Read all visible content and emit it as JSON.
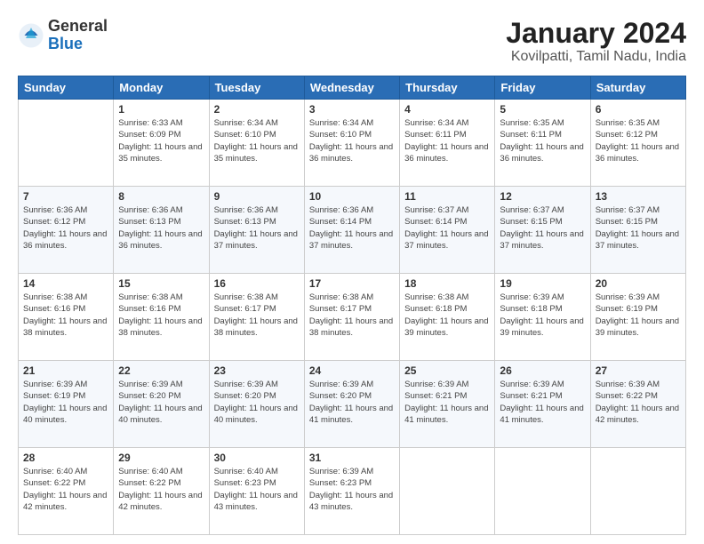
{
  "header": {
    "logo_general": "General",
    "logo_blue": "Blue",
    "main_title": "January 2024",
    "subtitle": "Kovilpatti, Tamil Nadu, India"
  },
  "days_of_week": [
    "Sunday",
    "Monday",
    "Tuesday",
    "Wednesday",
    "Thursday",
    "Friday",
    "Saturday"
  ],
  "weeks": [
    [
      {
        "day": "",
        "sunrise": "",
        "sunset": "",
        "daylight": ""
      },
      {
        "day": "1",
        "sunrise": "Sunrise: 6:33 AM",
        "sunset": "Sunset: 6:09 PM",
        "daylight": "Daylight: 11 hours and 35 minutes."
      },
      {
        "day": "2",
        "sunrise": "Sunrise: 6:34 AM",
        "sunset": "Sunset: 6:10 PM",
        "daylight": "Daylight: 11 hours and 35 minutes."
      },
      {
        "day": "3",
        "sunrise": "Sunrise: 6:34 AM",
        "sunset": "Sunset: 6:10 PM",
        "daylight": "Daylight: 11 hours and 36 minutes."
      },
      {
        "day": "4",
        "sunrise": "Sunrise: 6:34 AM",
        "sunset": "Sunset: 6:11 PM",
        "daylight": "Daylight: 11 hours and 36 minutes."
      },
      {
        "day": "5",
        "sunrise": "Sunrise: 6:35 AM",
        "sunset": "Sunset: 6:11 PM",
        "daylight": "Daylight: 11 hours and 36 minutes."
      },
      {
        "day": "6",
        "sunrise": "Sunrise: 6:35 AM",
        "sunset": "Sunset: 6:12 PM",
        "daylight": "Daylight: 11 hours and 36 minutes."
      }
    ],
    [
      {
        "day": "7",
        "sunrise": "Sunrise: 6:36 AM",
        "sunset": "Sunset: 6:12 PM",
        "daylight": "Daylight: 11 hours and 36 minutes."
      },
      {
        "day": "8",
        "sunrise": "Sunrise: 6:36 AM",
        "sunset": "Sunset: 6:13 PM",
        "daylight": "Daylight: 11 hours and 36 minutes."
      },
      {
        "day": "9",
        "sunrise": "Sunrise: 6:36 AM",
        "sunset": "Sunset: 6:13 PM",
        "daylight": "Daylight: 11 hours and 37 minutes."
      },
      {
        "day": "10",
        "sunrise": "Sunrise: 6:36 AM",
        "sunset": "Sunset: 6:14 PM",
        "daylight": "Daylight: 11 hours and 37 minutes."
      },
      {
        "day": "11",
        "sunrise": "Sunrise: 6:37 AM",
        "sunset": "Sunset: 6:14 PM",
        "daylight": "Daylight: 11 hours and 37 minutes."
      },
      {
        "day": "12",
        "sunrise": "Sunrise: 6:37 AM",
        "sunset": "Sunset: 6:15 PM",
        "daylight": "Daylight: 11 hours and 37 minutes."
      },
      {
        "day": "13",
        "sunrise": "Sunrise: 6:37 AM",
        "sunset": "Sunset: 6:15 PM",
        "daylight": "Daylight: 11 hours and 37 minutes."
      }
    ],
    [
      {
        "day": "14",
        "sunrise": "Sunrise: 6:38 AM",
        "sunset": "Sunset: 6:16 PM",
        "daylight": "Daylight: 11 hours and 38 minutes."
      },
      {
        "day": "15",
        "sunrise": "Sunrise: 6:38 AM",
        "sunset": "Sunset: 6:16 PM",
        "daylight": "Daylight: 11 hours and 38 minutes."
      },
      {
        "day": "16",
        "sunrise": "Sunrise: 6:38 AM",
        "sunset": "Sunset: 6:17 PM",
        "daylight": "Daylight: 11 hours and 38 minutes."
      },
      {
        "day": "17",
        "sunrise": "Sunrise: 6:38 AM",
        "sunset": "Sunset: 6:17 PM",
        "daylight": "Daylight: 11 hours and 38 minutes."
      },
      {
        "day": "18",
        "sunrise": "Sunrise: 6:38 AM",
        "sunset": "Sunset: 6:18 PM",
        "daylight": "Daylight: 11 hours and 39 minutes."
      },
      {
        "day": "19",
        "sunrise": "Sunrise: 6:39 AM",
        "sunset": "Sunset: 6:18 PM",
        "daylight": "Daylight: 11 hours and 39 minutes."
      },
      {
        "day": "20",
        "sunrise": "Sunrise: 6:39 AM",
        "sunset": "Sunset: 6:19 PM",
        "daylight": "Daylight: 11 hours and 39 minutes."
      }
    ],
    [
      {
        "day": "21",
        "sunrise": "Sunrise: 6:39 AM",
        "sunset": "Sunset: 6:19 PM",
        "daylight": "Daylight: 11 hours and 40 minutes."
      },
      {
        "day": "22",
        "sunrise": "Sunrise: 6:39 AM",
        "sunset": "Sunset: 6:20 PM",
        "daylight": "Daylight: 11 hours and 40 minutes."
      },
      {
        "day": "23",
        "sunrise": "Sunrise: 6:39 AM",
        "sunset": "Sunset: 6:20 PM",
        "daylight": "Daylight: 11 hours and 40 minutes."
      },
      {
        "day": "24",
        "sunrise": "Sunrise: 6:39 AM",
        "sunset": "Sunset: 6:20 PM",
        "daylight": "Daylight: 11 hours and 41 minutes."
      },
      {
        "day": "25",
        "sunrise": "Sunrise: 6:39 AM",
        "sunset": "Sunset: 6:21 PM",
        "daylight": "Daylight: 11 hours and 41 minutes."
      },
      {
        "day": "26",
        "sunrise": "Sunrise: 6:39 AM",
        "sunset": "Sunset: 6:21 PM",
        "daylight": "Daylight: 11 hours and 41 minutes."
      },
      {
        "day": "27",
        "sunrise": "Sunrise: 6:39 AM",
        "sunset": "Sunset: 6:22 PM",
        "daylight": "Daylight: 11 hours and 42 minutes."
      }
    ],
    [
      {
        "day": "28",
        "sunrise": "Sunrise: 6:40 AM",
        "sunset": "Sunset: 6:22 PM",
        "daylight": "Daylight: 11 hours and 42 minutes."
      },
      {
        "day": "29",
        "sunrise": "Sunrise: 6:40 AM",
        "sunset": "Sunset: 6:22 PM",
        "daylight": "Daylight: 11 hours and 42 minutes."
      },
      {
        "day": "30",
        "sunrise": "Sunrise: 6:40 AM",
        "sunset": "Sunset: 6:23 PM",
        "daylight": "Daylight: 11 hours and 43 minutes."
      },
      {
        "day": "31",
        "sunrise": "Sunrise: 6:39 AM",
        "sunset": "Sunset: 6:23 PM",
        "daylight": "Daylight: 11 hours and 43 minutes."
      },
      {
        "day": "",
        "sunrise": "",
        "sunset": "",
        "daylight": ""
      },
      {
        "day": "",
        "sunrise": "",
        "sunset": "",
        "daylight": ""
      },
      {
        "day": "",
        "sunrise": "",
        "sunset": "",
        "daylight": ""
      }
    ]
  ]
}
